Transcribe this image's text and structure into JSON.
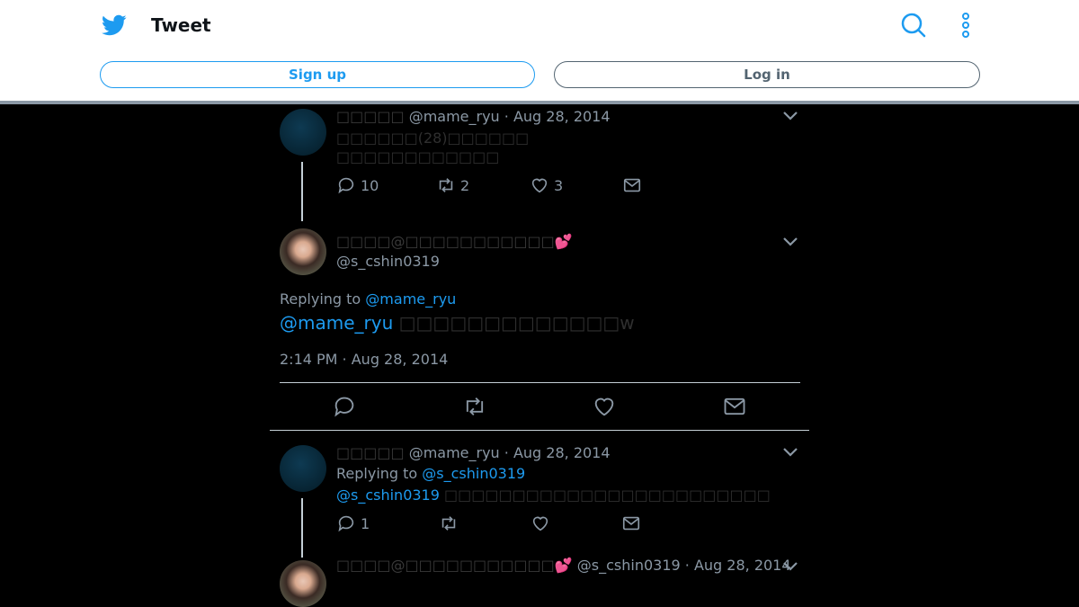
{
  "header": {
    "title": "Tweet",
    "signup_label": "Sign up",
    "login_label": "Log in",
    "accent": "#1d9bf0"
  },
  "tweets": [
    {
      "name": "□□□□□",
      "handle_date": "@mame_ryu · Aug 28, 2014",
      "lines": [
        "□□□□□□(28)□□□□□□",
        "□□□□□□□□□□□□"
      ],
      "replies": "10",
      "retweets": "2",
      "likes": "3"
    },
    {
      "name": "□□□□@□□□□□□□□□□□",
      "emoji": "💕",
      "handle": "@s_cshin0319",
      "replying_prefix": "Replying to ",
      "replying_handle": "@mame_ryu",
      "mention": "@mame_ryu",
      "text": " □□□□□□□□□□□□□w",
      "timestamp": "2:14 PM · Aug 28, 2014"
    },
    {
      "name": "□□□□□",
      "handle_date": "@mame_ryu · Aug 28, 2014",
      "replying_prefix": "Replying to ",
      "replying_handle": "@s_cshin0319",
      "mention": "@s_cshin0319",
      "text": " □□□□□□□□□□□□□□□□□□□□□□□□",
      "replies": "1"
    },
    {
      "name": "□□□□@□□□□□□□□□□□",
      "emoji": "💕",
      "handle_date": "@s_cshin0319 · Aug 28, 2014"
    }
  ]
}
